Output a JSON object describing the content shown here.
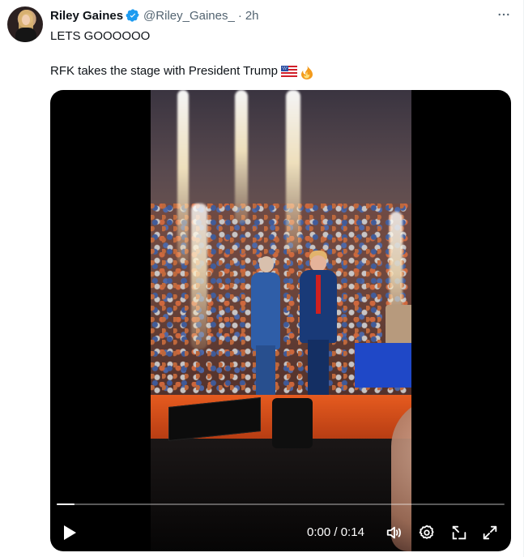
{
  "tweet": {
    "author_name": "Riley Gaines",
    "handle": "@Riley_Gaines_",
    "separator": "·",
    "time_ago": "2h",
    "text_line1": "LETS GOOOOOO",
    "text_line2": "RFK takes the stage with President Trump"
  },
  "video": {
    "current_time": "0:00",
    "duration": "0:14",
    "time_separator": "/",
    "progress_fraction": 0.04
  },
  "icons": {
    "verified": "verified-badge-icon",
    "more": "more-dots-icon",
    "flag": "us-flag-emoji",
    "fire": "fire-emoji",
    "play": "play-icon",
    "volume": "volume-icon",
    "settings": "settings-gear-icon",
    "pip": "picture-in-picture-icon",
    "fullscreen": "fullscreen-icon"
  },
  "colors": {
    "brand_blue": "#1d9bf0",
    "text": "#0f1419",
    "secondary": "#536471"
  }
}
